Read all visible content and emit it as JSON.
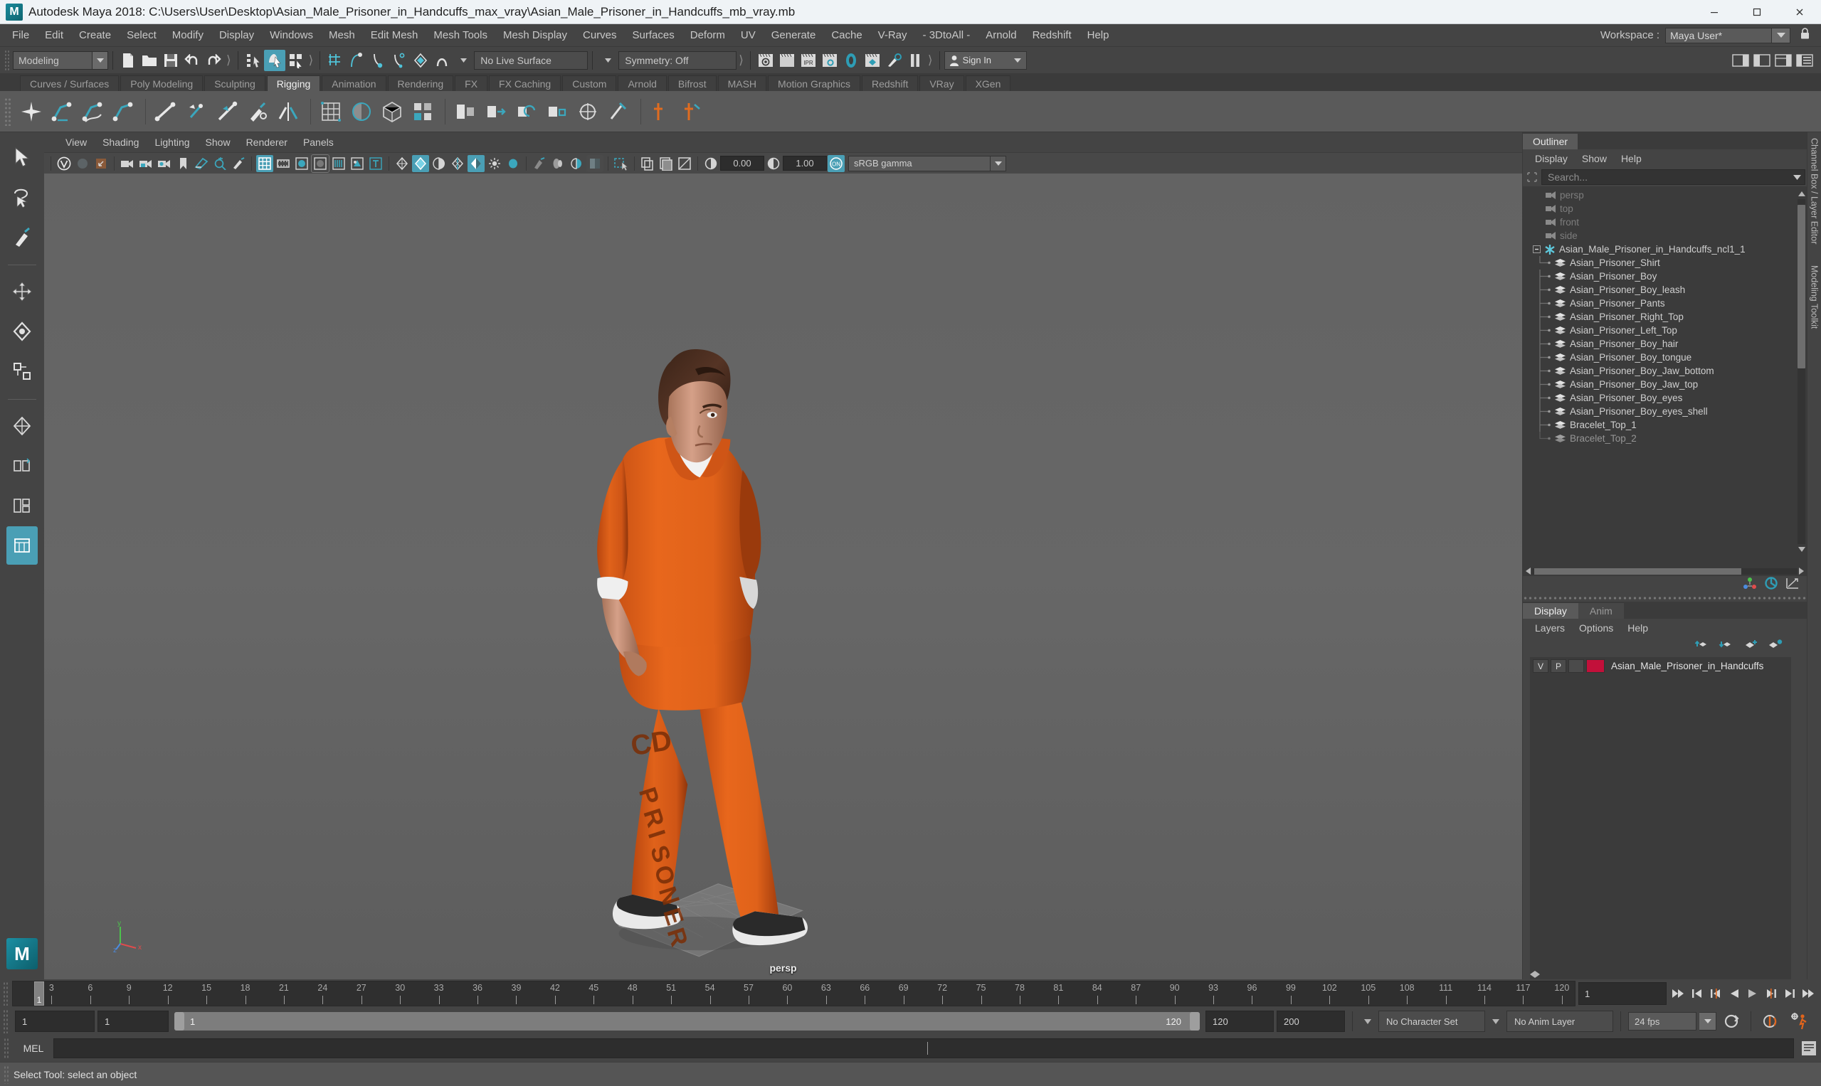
{
  "window": {
    "title": "Autodesk Maya 2018: C:\\Users\\User\\Desktop\\Asian_Male_Prisoner_in_Handcuffs_max_vray\\Asian_Male_Prisoner_in_Handcuffs_mb_vray.mb",
    "logo_letter": "M",
    "minimize": "minimize-icon",
    "maximize": "maximize-icon",
    "close": "close-icon"
  },
  "menubar": {
    "items": [
      "File",
      "Edit",
      "Create",
      "Select",
      "Modify",
      "Display",
      "Windows",
      "Mesh",
      "Edit Mesh",
      "Mesh Tools",
      "Mesh Display",
      "Curves",
      "Surfaces",
      "Deform",
      "UV",
      "Generate",
      "Cache",
      "V-Ray",
      "- 3DtoAll -",
      "Arnold",
      "Redshift",
      "Help"
    ],
    "workspace_label": "Workspace :",
    "workspace_value": "Maya User*"
  },
  "statusline": {
    "mode": "Modeling",
    "live_surface": "No Live Surface",
    "symmetry": "Symmetry: Off",
    "signin": "Sign In"
  },
  "shelf": {
    "tabs": [
      "Curves / Surfaces",
      "Poly Modeling",
      "Sculpting",
      "Rigging",
      "Animation",
      "Rendering",
      "FX",
      "FX Caching",
      "Custom",
      "Arnold",
      "Bifrost",
      "MASH",
      "Motion Graphics",
      "Redshift",
      "VRay",
      "XGen"
    ],
    "active_tab": "Rigging"
  },
  "viewport": {
    "menus": [
      "View",
      "Shading",
      "Lighting",
      "Show",
      "Renderer",
      "Panels"
    ],
    "exposure": "0.00",
    "gamma_value": "1.00",
    "color_space": "sRGB gamma",
    "camera_label": "persp",
    "axis": {
      "x": "x",
      "y": "y",
      "z": "z"
    }
  },
  "outliner": {
    "title": "Outliner",
    "menus": [
      "Display",
      "Show",
      "Help"
    ],
    "search_placeholder": "Search...",
    "items": [
      {
        "label": "persp",
        "icon": "camera-icon",
        "depth": 1,
        "dim": true
      },
      {
        "label": "top",
        "icon": "camera-icon",
        "depth": 1,
        "dim": true
      },
      {
        "label": "front",
        "icon": "camera-icon",
        "depth": 1,
        "dim": true
      },
      {
        "label": "side",
        "icon": "camera-icon",
        "depth": 1,
        "dim": true
      },
      {
        "label": "Asian_Male_Prisoner_in_Handcuffs_ncl1_1",
        "icon": "asterisk-icon",
        "depth": 0,
        "dim": false,
        "expanded": true
      },
      {
        "label": "Asian_Prisoner_Shirt",
        "icon": "mesh-icon",
        "depth": 2,
        "dim": false
      },
      {
        "label": "Asian_Prisoner_Boy",
        "icon": "mesh-icon",
        "depth": 2,
        "dim": false
      },
      {
        "label": "Asian_Prisoner_Boy_leash",
        "icon": "mesh-icon",
        "depth": 2,
        "dim": false
      },
      {
        "label": "Asian_Prisoner_Pants",
        "icon": "mesh-icon",
        "depth": 2,
        "dim": false
      },
      {
        "label": "Asian_Prisoner_Right_Top",
        "icon": "mesh-icon",
        "depth": 2,
        "dim": false
      },
      {
        "label": "Asian_Prisoner_Left_Top",
        "icon": "mesh-icon",
        "depth": 2,
        "dim": false
      },
      {
        "label": "Asian_Prisoner_Boy_hair",
        "icon": "mesh-icon",
        "depth": 2,
        "dim": false
      },
      {
        "label": "Asian_Prisoner_Boy_tongue",
        "icon": "mesh-icon",
        "depth": 2,
        "dim": false
      },
      {
        "label": "Asian_Prisoner_Boy_Jaw_bottom",
        "icon": "mesh-icon",
        "depth": 2,
        "dim": false
      },
      {
        "label": "Asian_Prisoner_Boy_Jaw_top",
        "icon": "mesh-icon",
        "depth": 2,
        "dim": false
      },
      {
        "label": "Asian_Prisoner_Boy_eyes",
        "icon": "mesh-icon",
        "depth": 2,
        "dim": false
      },
      {
        "label": "Asian_Prisoner_Boy_eyes_shell",
        "icon": "mesh-icon",
        "depth": 2,
        "dim": false
      },
      {
        "label": "Bracelet_Top_1",
        "icon": "mesh-icon",
        "depth": 2,
        "dim": false
      },
      {
        "label": "Bracelet_Top_2",
        "icon": "mesh-icon",
        "depth": 2,
        "dim": false
      }
    ]
  },
  "layer_editor": {
    "tabs": [
      {
        "label": "Display",
        "active": true
      },
      {
        "label": "Anim",
        "active": false
      }
    ],
    "menus": [
      "Layers",
      "Options",
      "Help"
    ],
    "rows": [
      {
        "visibility": "V",
        "playback": "P",
        "shade": "",
        "color": "#c2103a",
        "name": "Asian_Male_Prisoner_in_Handcuffs"
      }
    ],
    "side_label": "Channel Box / Layer Editor",
    "modeling_toolkit_label": "Modeling Toolkit"
  },
  "timeslider": {
    "ticks": [
      3,
      6,
      9,
      12,
      15,
      18,
      21,
      24,
      27,
      30,
      33,
      36,
      39,
      42,
      45,
      48,
      51,
      54,
      57,
      60,
      63,
      66,
      69,
      72,
      75,
      78,
      81,
      84,
      87,
      90,
      93,
      96,
      99,
      102,
      105,
      108,
      111,
      114,
      117,
      120
    ],
    "current_frame": "1",
    "frame_field": "1",
    "playback_buttons": [
      "go-to-start-icon",
      "step-back-keyframe-icon",
      "step-back-frame-icon",
      "play-backwards-icon",
      "play-forwards-icon",
      "step-forward-frame-icon",
      "step-forward-keyframe-icon",
      "go-to-end-icon"
    ]
  },
  "range": {
    "anim_start": "1",
    "range_start": "1",
    "bar_start": "1",
    "bar_end": "120",
    "range_end": "120",
    "anim_end": "200",
    "character_set": "No Character Set",
    "anim_layer": "No Anim Layer",
    "fps": "24 fps"
  },
  "command": {
    "language_label": "MEL",
    "input_value": "",
    "status_text": "Select Tool: select an object"
  },
  "colors": {
    "accent": "#4a9fb5",
    "panel_bg": "#444444",
    "field_bg": "#2d2d2d",
    "layer_swatch": "#c2103a",
    "orange": "#e0641c"
  }
}
